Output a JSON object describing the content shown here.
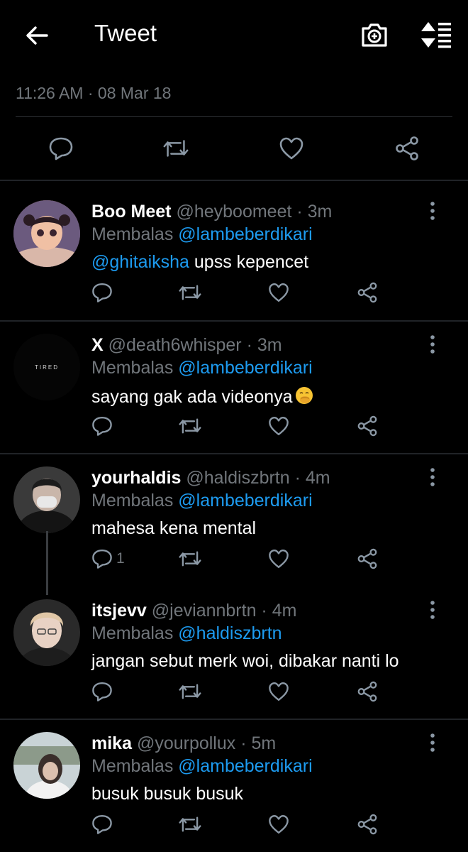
{
  "header": {
    "title": "Tweet"
  },
  "tweet": {
    "timestamp": "11:26 AM · 08 Mar 18"
  },
  "replies": [
    {
      "name": "Boo Meet",
      "handle": "@heyboomeet · 3m",
      "reply_prefix": "Membalas",
      "reply_to": "@lambeberdikari",
      "text_mention": "@ghitaiksha",
      "text": " upss kepencet",
      "reply_count": ""
    },
    {
      "name": "X",
      "handle": "@death6whisper · 3m",
      "reply_prefix": "Membalas",
      "reply_to": "@lambeberdikari",
      "text_mention": "",
      "text": "sayang gak ada videonya",
      "avatar_text": "TIRED",
      "reply_count": ""
    },
    {
      "name": "yourhaldis",
      "handle": "@haldiszbrtn · 4m",
      "reply_prefix": "Membalas",
      "reply_to": "@lambeberdikari",
      "text_mention": "",
      "text": "mahesa kena mental",
      "reply_count": "1"
    },
    {
      "name": "itsjevv",
      "handle": "@jeviannbrtn · 4m",
      "reply_prefix": "Membalas",
      "reply_to": "@haldiszbrtn",
      "text_mention": "",
      "text": "jangan sebut merk woi, dibakar nanti lo",
      "reply_count": ""
    },
    {
      "name": "mika",
      "handle": "@yourpollux · 5m",
      "reply_prefix": "Membalas",
      "reply_to": "@lambeberdikari",
      "text_mention": "",
      "text": "busuk busuk busuk",
      "reply_count": ""
    }
  ],
  "colors": {
    "background": "#000000",
    "accent": "#1d9bf0",
    "muted": "#71767b"
  }
}
